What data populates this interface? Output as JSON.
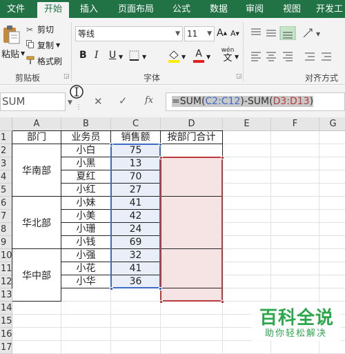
{
  "tabs": [
    {
      "label": "文件",
      "active": false
    },
    {
      "label": "开始",
      "active": true
    },
    {
      "label": "插入",
      "active": false
    },
    {
      "label": "页面布局",
      "active": false
    },
    {
      "label": "公式",
      "active": false
    },
    {
      "label": "数据",
      "active": false
    },
    {
      "label": "审阅",
      "active": false
    },
    {
      "label": "视图",
      "active": false
    },
    {
      "label": "开发工",
      "active": false
    }
  ],
  "ribbon": {
    "paste": "粘贴",
    "cut": "剪切",
    "copy": "复制",
    "format_painter": "格式刷",
    "clipboard_label": "剪贴板",
    "font_name": "等线",
    "font_size": "11",
    "font_label": "字体",
    "align_label": "对齐方式",
    "wen": "wén",
    "wen_char": "文",
    "bold": "B",
    "italic": "I",
    "underline": "U",
    "font_color_letter": "A",
    "grow_font": "A",
    "shrink_font": "A"
  },
  "formula_bar": {
    "name_box": "SUM",
    "fx": "fx",
    "formula_prefix": "=SUM(",
    "ref1": "C2:C12",
    "formula_mid": ")-SUM(",
    "ref2": "D3:D13",
    "formula_suffix": ")",
    "ref1_color": "#3b6bc4",
    "ref2_color": "#b83a3a"
  },
  "columns": [
    "A",
    "B",
    "C",
    "D",
    "E",
    "F",
    "G"
  ],
  "rows": [
    "1",
    "2",
    "3",
    "4",
    "5",
    "6",
    "7",
    "8",
    "9",
    "10",
    "11",
    "12",
    "13",
    "14",
    "15",
    "16",
    "17"
  ],
  "table": {
    "headers": [
      "部门",
      "业务员",
      "销售额",
      "按部门合计"
    ],
    "groups": [
      "华南部",
      "华北部",
      "华中部"
    ],
    "staff": [
      "小白",
      "小黑",
      "夏红",
      "小红",
      "小妹",
      "小美",
      "小珊",
      "小钱",
      "小强",
      "小花",
      "小华"
    ],
    "sales": [
      "75",
      "13",
      "70",
      "27",
      "41",
      "42",
      "24",
      "69",
      "32",
      "41",
      "36"
    ]
  },
  "colors": {
    "excel_green": "#217346",
    "ref1_fill": "#e9eef8",
    "ref1_border": "#3b6bc4",
    "ref2_fill": "#f6e3e3",
    "ref2_border": "#b83a3a"
  },
  "watermark": {
    "title": "百科全说",
    "subtitle": "助你轻松解决",
    "color": "#2aa84a"
  }
}
